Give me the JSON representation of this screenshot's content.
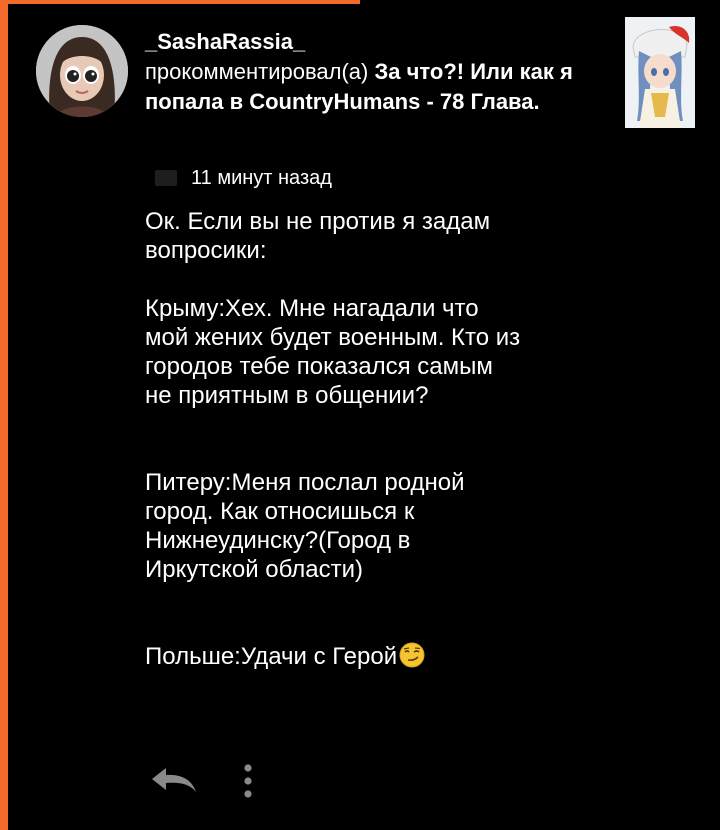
{
  "comment": {
    "username": "_SashaRassia_",
    "action_text": "прокомментировал(а)",
    "post_title": "За что?! Или как я попала в CountryHumans - 78 Глава.",
    "timestamp": "11 минут назад",
    "body": "Ок. Если вы не против я задам\nвопросики:\n\nКрыму:Хех. Мне нагадали что\nмой жених будет военным. Кто из\nгородов тебе показался самым\nне приятным в общении?\n\n\nПитеру:Меня послал родной\nгород. Как относишься к\nНижнеудинску?(Город в\nИркутской области)\n\n\nПольше:Удачи с Герой",
    "body_emoji": "smirking-face"
  },
  "icons": {
    "reply": "reply-arrow-icon",
    "more": "more-vertical-icon",
    "clock": "clock-icon"
  },
  "colors": {
    "accent": "#f26a2c",
    "background": "#000000",
    "text": "#ffffff"
  }
}
